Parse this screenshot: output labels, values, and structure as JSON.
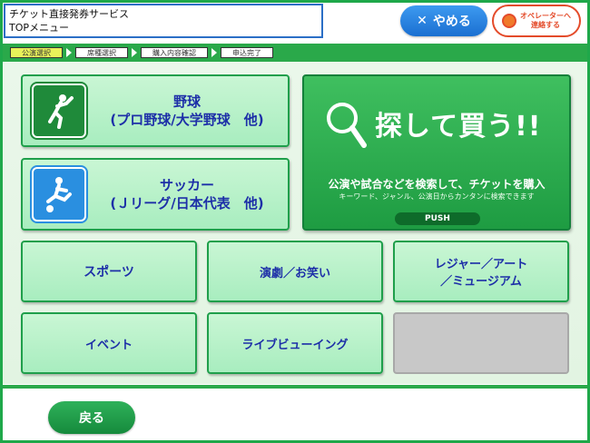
{
  "header": {
    "service_name": "チケット直接発券サービス",
    "screen_name": "TOPメニュー"
  },
  "top_buttons": {
    "cancel_label": "やめる",
    "operator_label_line1": "オペレーターへ",
    "operator_label_line2": "連絡する"
  },
  "steps": [
    {
      "label": "公演選択",
      "active": true
    },
    {
      "label": "席種選択",
      "active": false
    },
    {
      "label": "購入内容確認",
      "active": false
    },
    {
      "label": "申込完了",
      "active": false
    }
  ],
  "menu": {
    "baseball_line1": "野球",
    "baseball_line2": "(プロ野球/大学野球　他)",
    "soccer_line1": "サッカー",
    "soccer_line2": "(Ｊリーグ/日本代表　他)",
    "search_title": "探して買う!!",
    "search_desc": "公演や試合などを検索して、チケットを購入",
    "search_sub": "キーワード、ジャンル、公演日からカンタンに検索できます",
    "push_label": "PUSH",
    "sports": "スポーツ",
    "theater": "演劇／お笑い",
    "leisure_line1": "レジャー／アート",
    "leisure_line2": "／ミュージアム",
    "event": "イベント",
    "live_viewing": "ライブビューイング"
  },
  "footer": {
    "back_label": "戻る"
  },
  "colors": {
    "accent_green": "#2aa94a",
    "button_blue": "#1a6fd1",
    "operator_red": "#e44b2a",
    "label_blue": "#1d2fa8"
  }
}
